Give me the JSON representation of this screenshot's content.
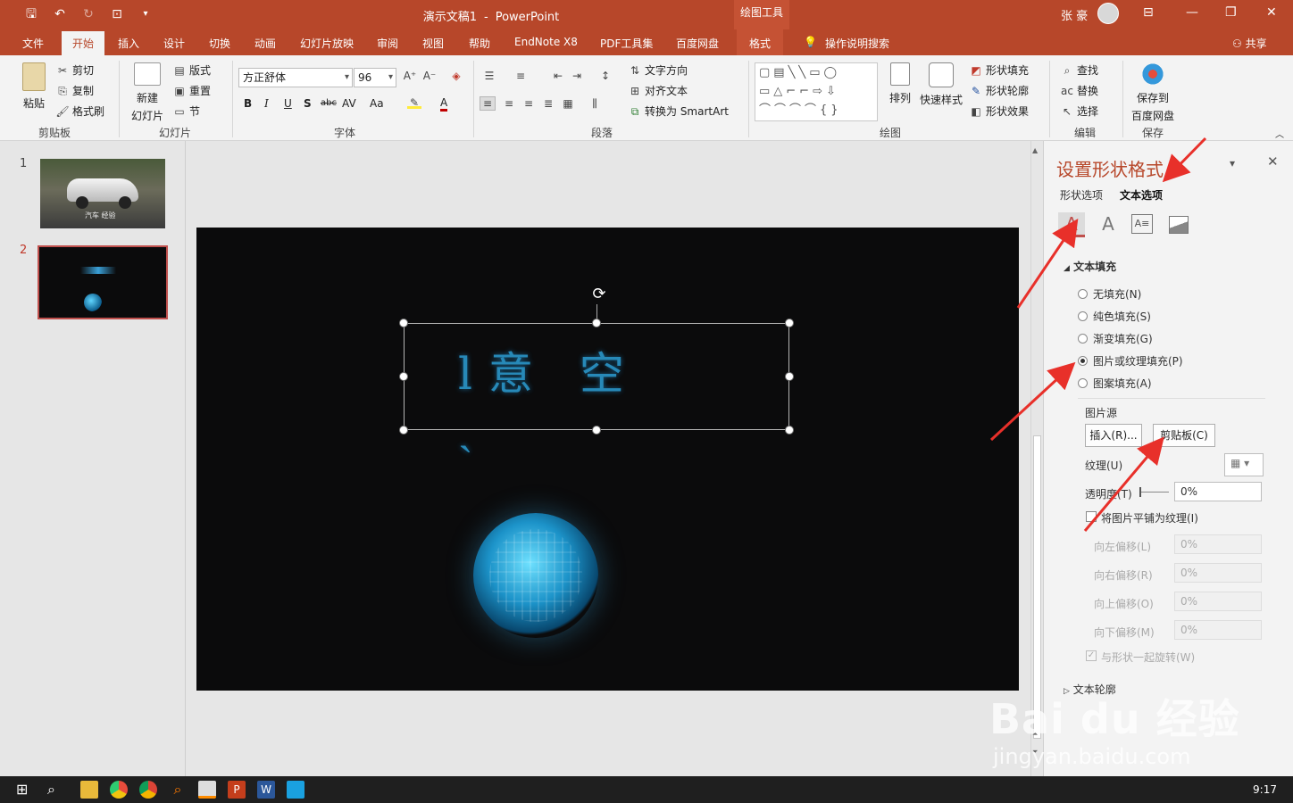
{
  "window": {
    "doc_name": "演示文稿1",
    "dash": "-",
    "app_name": "PowerPoint",
    "context_tools": "绘图工具",
    "user_name": "张 豪",
    "share": "共享"
  },
  "tabs": [
    "文件",
    "开始",
    "插入",
    "设计",
    "切换",
    "动画",
    "幻灯片放映",
    "审阅",
    "视图",
    "帮助",
    "EndNote X8",
    "PDF工具集",
    "百度网盘",
    "格式",
    "操作说明搜索"
  ],
  "ribbon": {
    "clipboard": {
      "paste": "粘贴",
      "cut": "剪切",
      "copy": "复制",
      "format_painter": "格式刷",
      "label": "剪贴板"
    },
    "slides": {
      "new_slide_1": "新建",
      "new_slide_2": "幻灯片",
      "layout": "版式",
      "reset": "重置",
      "section": "节",
      "label": "幻灯片"
    },
    "font": {
      "name": "方正舒体",
      "size": "96",
      "bold": "B",
      "italic": "I",
      "underline": "U",
      "shadow": "S",
      "strike": "abc",
      "spacing": "AV",
      "case": "Aa",
      "color": "A",
      "label": "字体"
    },
    "paragraph": {
      "text_dir": "文字方向",
      "align_text": "对齐文本",
      "smartart": "转换为 SmartArt",
      "label": "段落"
    },
    "drawing": {
      "arrange": "排列",
      "quick_styles": "快速样式",
      "shape_fill": "形状填充",
      "shape_outline": "形状轮廓",
      "shape_effects": "形状效果",
      "label": "绘图"
    },
    "editing": {
      "find": "查找",
      "replace": "替换",
      "select": "选择",
      "label": "编辑"
    },
    "save": {
      "btn_1": "保存到",
      "btn_2": "百度网盘",
      "label": "保存"
    }
  },
  "thumbnails": [
    {
      "num": "1",
      "caption": "汽车 经验"
    },
    {
      "num": "2"
    }
  ],
  "pane": {
    "title": "设置形状格式",
    "tab_shape": "形状选项",
    "tab_text": "文本选项",
    "section_fill": "文本填充",
    "options": [
      "无填充(N)",
      "纯色填充(S)",
      "渐变填充(G)",
      "图片或纹理填充(P)",
      "图案填充(A)"
    ],
    "selected_option": "图片或纹理填充(P)",
    "picture_source": "图片源",
    "insert_btn": "插入(R)...",
    "clipboard_btn": "剪贴板(C)",
    "texture": "纹理(U)",
    "transparency": "透明度(T)",
    "transparency_value": "0%",
    "tile": "将图片平铺为纹理(I)",
    "offsets": [
      {
        "label": "向左偏移(L)",
        "value": "0%"
      },
      {
        "label": "向右偏移(R)",
        "value": "0%"
      },
      {
        "label": "向上偏移(O)",
        "value": "0%"
      },
      {
        "label": "向下偏移(M)",
        "value": "0%"
      }
    ],
    "rotate_with_shape": "与形状一起旋转(W)",
    "section_outline": "文本轮廓"
  },
  "taskbar": {
    "clock": "9:17"
  },
  "watermark": {
    "logo": "Bai du 经验",
    "url": "jingyan.baidu.com"
  }
}
